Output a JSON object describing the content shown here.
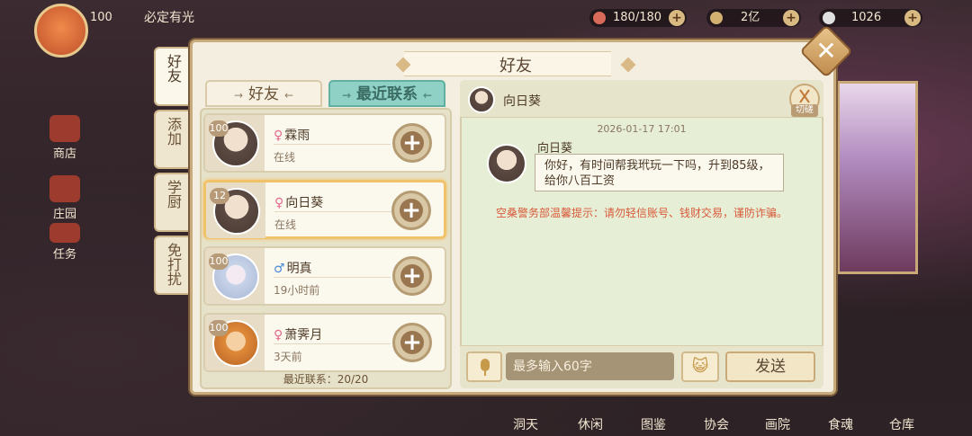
{
  "hud": {
    "player_level": "100",
    "player_name": "必定有光",
    "stamina": "180/180",
    "currency1": "2亿",
    "currency2": "1026",
    "left_menu": [
      "商店",
      "庄园",
      "任务"
    ],
    "bottom_nav": [
      "洞天",
      "休闲",
      "图鉴",
      "协会",
      "画院",
      "食魂",
      "仓库"
    ]
  },
  "panel": {
    "title": "好友",
    "side_tabs": [
      "好友",
      "添加",
      "学厨",
      "免打扰"
    ],
    "list_tabs": {
      "friends": "好友",
      "recent": "最近联系"
    },
    "recent_count_label": "最近联系：20/20"
  },
  "friends": [
    {
      "level": "100",
      "gender": "♀",
      "name": "霖雨",
      "status": "在线",
      "selected": false
    },
    {
      "level": "12",
      "gender": "♀",
      "name": "向日葵",
      "status": "在线",
      "selected": true
    },
    {
      "level": "100",
      "gender": "♂",
      "name": "明真",
      "status": "19小时前",
      "selected": false
    },
    {
      "level": "100",
      "gender": "♀",
      "name": "萧霁月",
      "status": "3天前",
      "selected": false
    }
  ],
  "chat": {
    "contact_name": "向日葵",
    "duel_label": "切磋",
    "timestamp": "2026-01-17  17:01",
    "message_sender": "向日葵",
    "message_text": "你好，有时间帮我玳玩一下吗，升到85级，给你八百工资",
    "warning": "空桑警务部温馨提示：请勿轻信账号、钱财交易，谨防诈骗。",
    "input_placeholder": "最多输入60字",
    "send_label": "发送"
  },
  "colors": {
    "accent_tab": "#8fd1c5",
    "warning_text": "#d85a3a",
    "selected_border": "#f0c36a",
    "female": "#e36a8d",
    "male": "#4e8bd6"
  }
}
